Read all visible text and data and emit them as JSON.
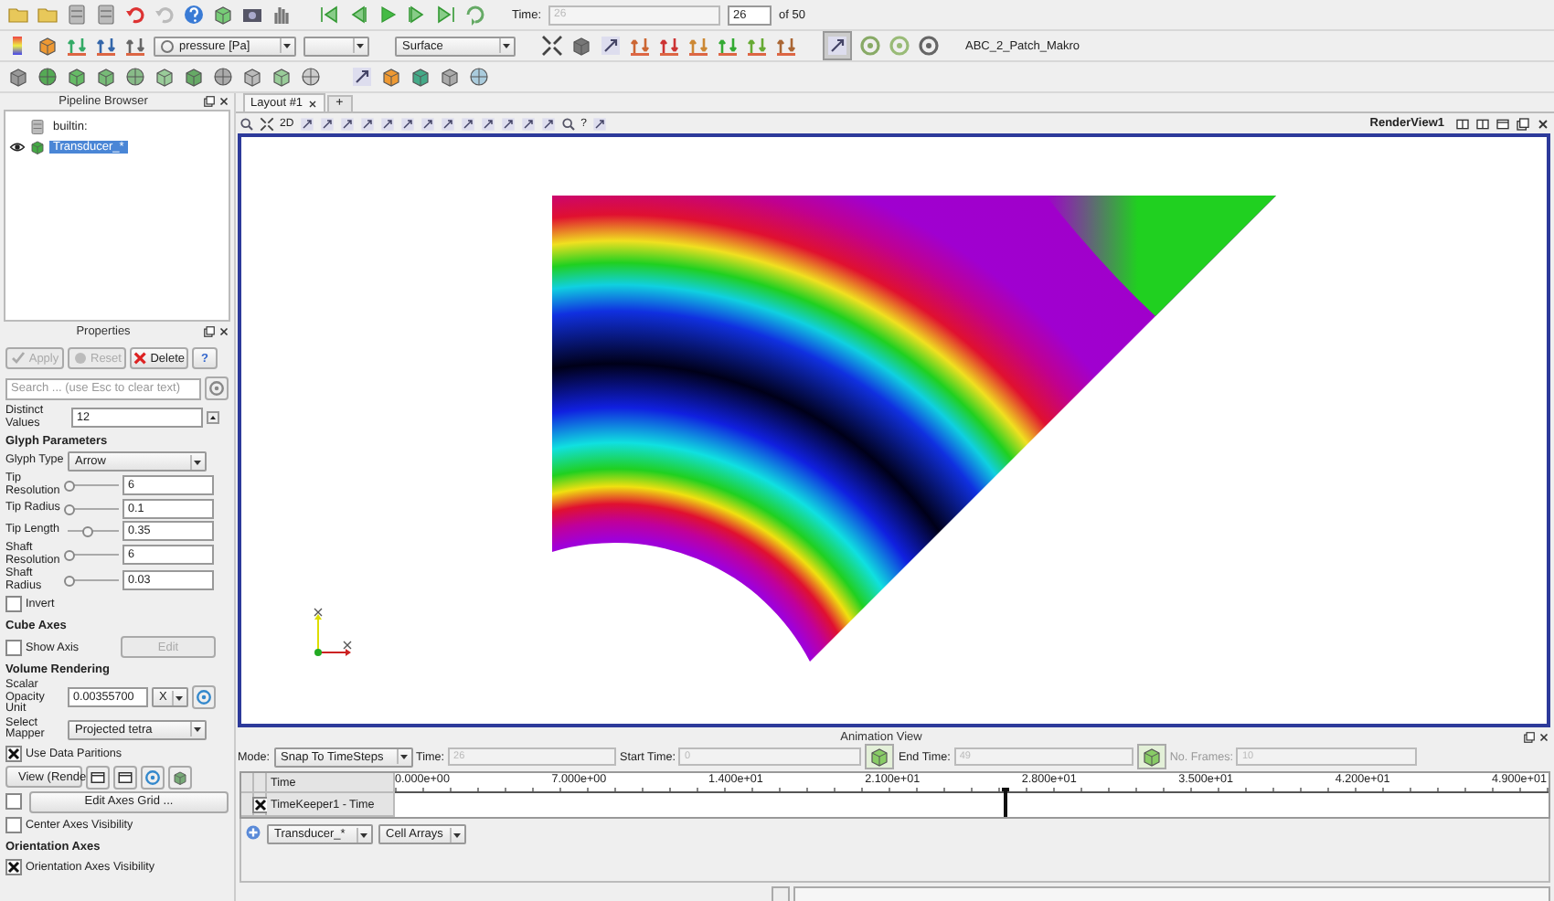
{
  "toolbar": {
    "time_label": "Time:",
    "time_value": "26",
    "time_step": "26",
    "time_total": "of 50",
    "color_by": "pressure [Pa]",
    "representation": "Surface",
    "macro": "ABC_2_Patch_Makro"
  },
  "pipeline_browser": {
    "title": "Pipeline Browser",
    "items": [
      {
        "label": "builtin:",
        "selected": false,
        "children": [
          {
            "label": "Transducer_*",
            "selected": true,
            "visible": true
          }
        ]
      }
    ]
  },
  "properties": {
    "title": "Properties",
    "buttons": [
      {
        "label": "Apply",
        "disabled": true
      },
      {
        "label": "Reset",
        "disabled": true
      },
      {
        "label": "Delete",
        "disabled": false
      },
      {
        "label": "?",
        "disabled": false
      }
    ],
    "search": {
      "placeholder": "Search ... (use Esc to clear text)"
    },
    "rows": [
      {
        "kind": "spin",
        "label": "Distinct Values",
        "value": "12"
      },
      {
        "kind": "section",
        "label": "Glyph Parameters"
      },
      {
        "kind": "combo",
        "label": "Glyph Type",
        "value": "Arrow"
      },
      {
        "kind": "slider",
        "label": "Tip Resolution",
        "level": 0.05,
        "value": "6"
      },
      {
        "kind": "slider",
        "label": "Tip Radius",
        "level": 0.05,
        "value": "0.1"
      },
      {
        "kind": "slider",
        "label": "Tip Length",
        "level": 0.4,
        "value": "0.35"
      },
      {
        "kind": "slider",
        "label": "Shaft Resolution",
        "level": 0.05,
        "value": "6"
      },
      {
        "kind": "slider",
        "label": "Shaft Radius",
        "level": 0.05,
        "value": "0.03"
      },
      {
        "kind": "check",
        "label": "Invert",
        "checked": false
      },
      {
        "kind": "section",
        "label": "Cube Axes"
      },
      {
        "kind": "check_button",
        "label": "Show Axis",
        "checked": false,
        "button": "Edit",
        "disabled": true
      },
      {
        "kind": "section",
        "label": "Volume Rendering"
      },
      {
        "kind": "field_combo",
        "label": "Scalar Opacity Unit",
        "value": "0.00355700",
        "option": "X"
      },
      {
        "kind": "combo",
        "label": "Select Mapper",
        "value": "Projected tetra"
      },
      {
        "kind": "check",
        "label": "Use Data Paritions",
        "checked": true
      },
      {
        "kind": "view",
        "label": "View (Rende"
      },
      {
        "kind": "wide_button",
        "button": "Edit Axes Grid ...",
        "checked": false,
        "disabled": false
      },
      {
        "kind": "check",
        "label": "Center Axes Visibility",
        "checked": false
      },
      {
        "kind": "section",
        "label": "Orientation Axes"
      },
      {
        "kind": "check",
        "label": "Orientation Axes Visibility",
        "checked": true
      }
    ]
  },
  "layout_tabs": [
    {
      "label": "Layout #1",
      "selected": true
    }
  ],
  "add_tab": "+",
  "view_toolbar": {
    "mode_2d": "2D",
    "help": "?"
  },
  "render_view": {
    "title": "RenderView1"
  },
  "animation": {
    "title": "Animation View",
    "mode_label": "Mode:",
    "mode": "Snap To TimeSteps",
    "time_label": "Time:",
    "time": "26",
    "start_label": "Start Time:",
    "start": "0",
    "end_label": "End Time:",
    "end": "49",
    "frames_label": "No. Frames:",
    "frames": "10",
    "header": "Time",
    "ticks": [
      "0.000e+00",
      "7.000e+00",
      "1.400e+01",
      "2.100e+01",
      "2.800e+01",
      "3.500e+01",
      "4.200e+01",
      "4.900e+01"
    ],
    "level": 0.53,
    "tracks": [
      {
        "label": "TimeKeeper1 - Time",
        "checked": true
      }
    ],
    "source": "Transducer_*",
    "arrays": "Cell Arrays"
  }
}
